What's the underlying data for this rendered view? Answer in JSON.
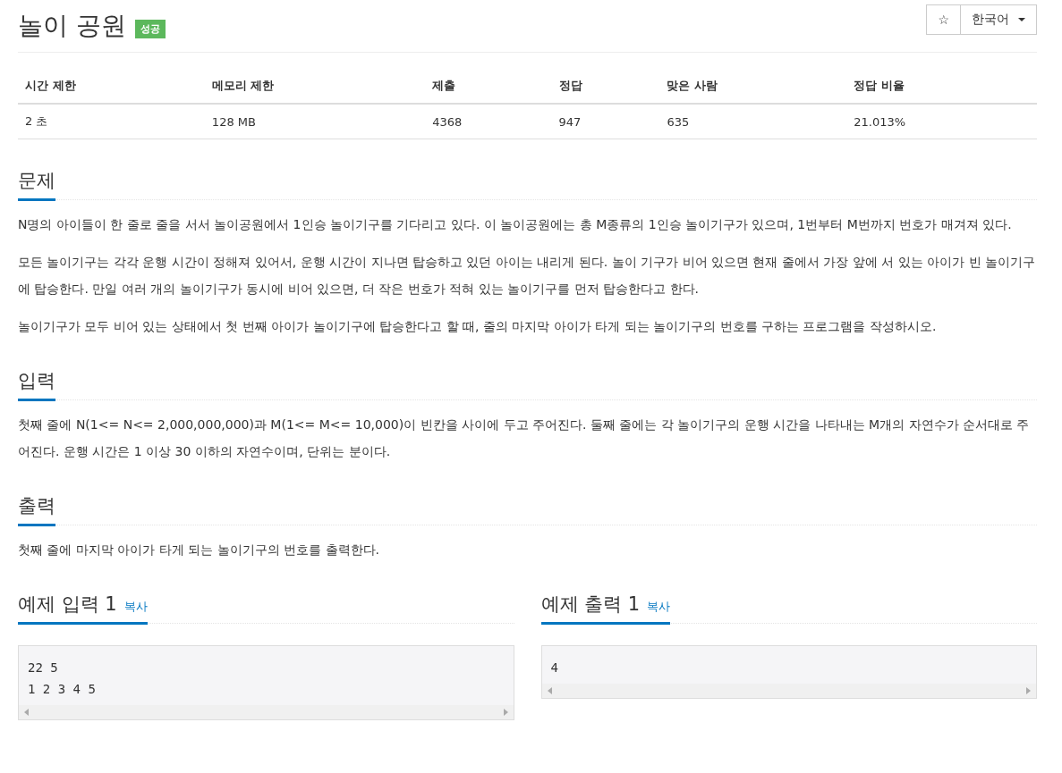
{
  "title": "놀이 공원",
  "result_badge": "성공",
  "favorite_button": "☆",
  "language_dropdown": "한국어",
  "info_table": {
    "columns": [
      "시간 제한",
      "메모리 제한",
      "제출",
      "정답",
      "맞은 사람",
      "정답 비율"
    ],
    "rows": [
      [
        "2 초",
        "128 MB",
        "4368",
        "947",
        "635",
        "21.013%"
      ]
    ]
  },
  "sections": [
    {
      "heading": "문제",
      "paragraphs": [
        "N명의 아이들이 한 줄로 줄을 서서 놀이공원에서 1인승 놀이기구를 기다리고 있다. 이 놀이공원에는 총 M종류의 1인승 놀이기구가 있으며, 1번부터 M번까지 번호가 매겨져 있다.",
        "모든 놀이기구는 각각 운행 시간이 정해져 있어서, 운행 시간이 지나면 탑승하고 있던 아이는 내리게 된다. 놀이 기구가 비어 있으면 현재 줄에서 가장 앞에 서 있는 아이가 빈 놀이기구에 탑승한다. 만일 여러 개의 놀이기구가 동시에 비어 있으면, 더 작은 번호가 적혀 있는 놀이기구를 먼저 탑승한다고 한다.",
        "놀이기구가 모두 비어 있는 상태에서 첫 번째 아이가 놀이기구에 탑승한다고 할 때, 줄의 마지막 아이가 타게 되는 놀이기구의 번호를 구하는 프로그램을 작성하시오."
      ]
    },
    {
      "heading": "입력",
      "paragraphs": [
        "첫째 줄에 N(1<= N<= 2,000,000,000)과 M(1<= M<= 10,000)이 빈칸을 사이에 두고 주어진다. 둘째 줄에는 각 놀이기구의 운행 시간을 나타내는 M개의 자연수가 순서대로 주어진다. 운행 시간은 1 이상 30 이하의 자연수이며, 단위는 분이다."
      ]
    },
    {
      "heading": "출력",
      "paragraphs": [
        "첫째 줄에 마지막 아이가 타게 되는 놀이기구의 번호를 출력한다."
      ]
    }
  ],
  "samples": [
    {
      "heading": "예제 입력 1",
      "copy_link": "복사",
      "lines": [
        "22 5",
        "1 2 3 4 5"
      ]
    },
    {
      "heading": "예제 출력 1",
      "copy_link": "복사",
      "lines": [
        "4"
      ]
    }
  ]
}
